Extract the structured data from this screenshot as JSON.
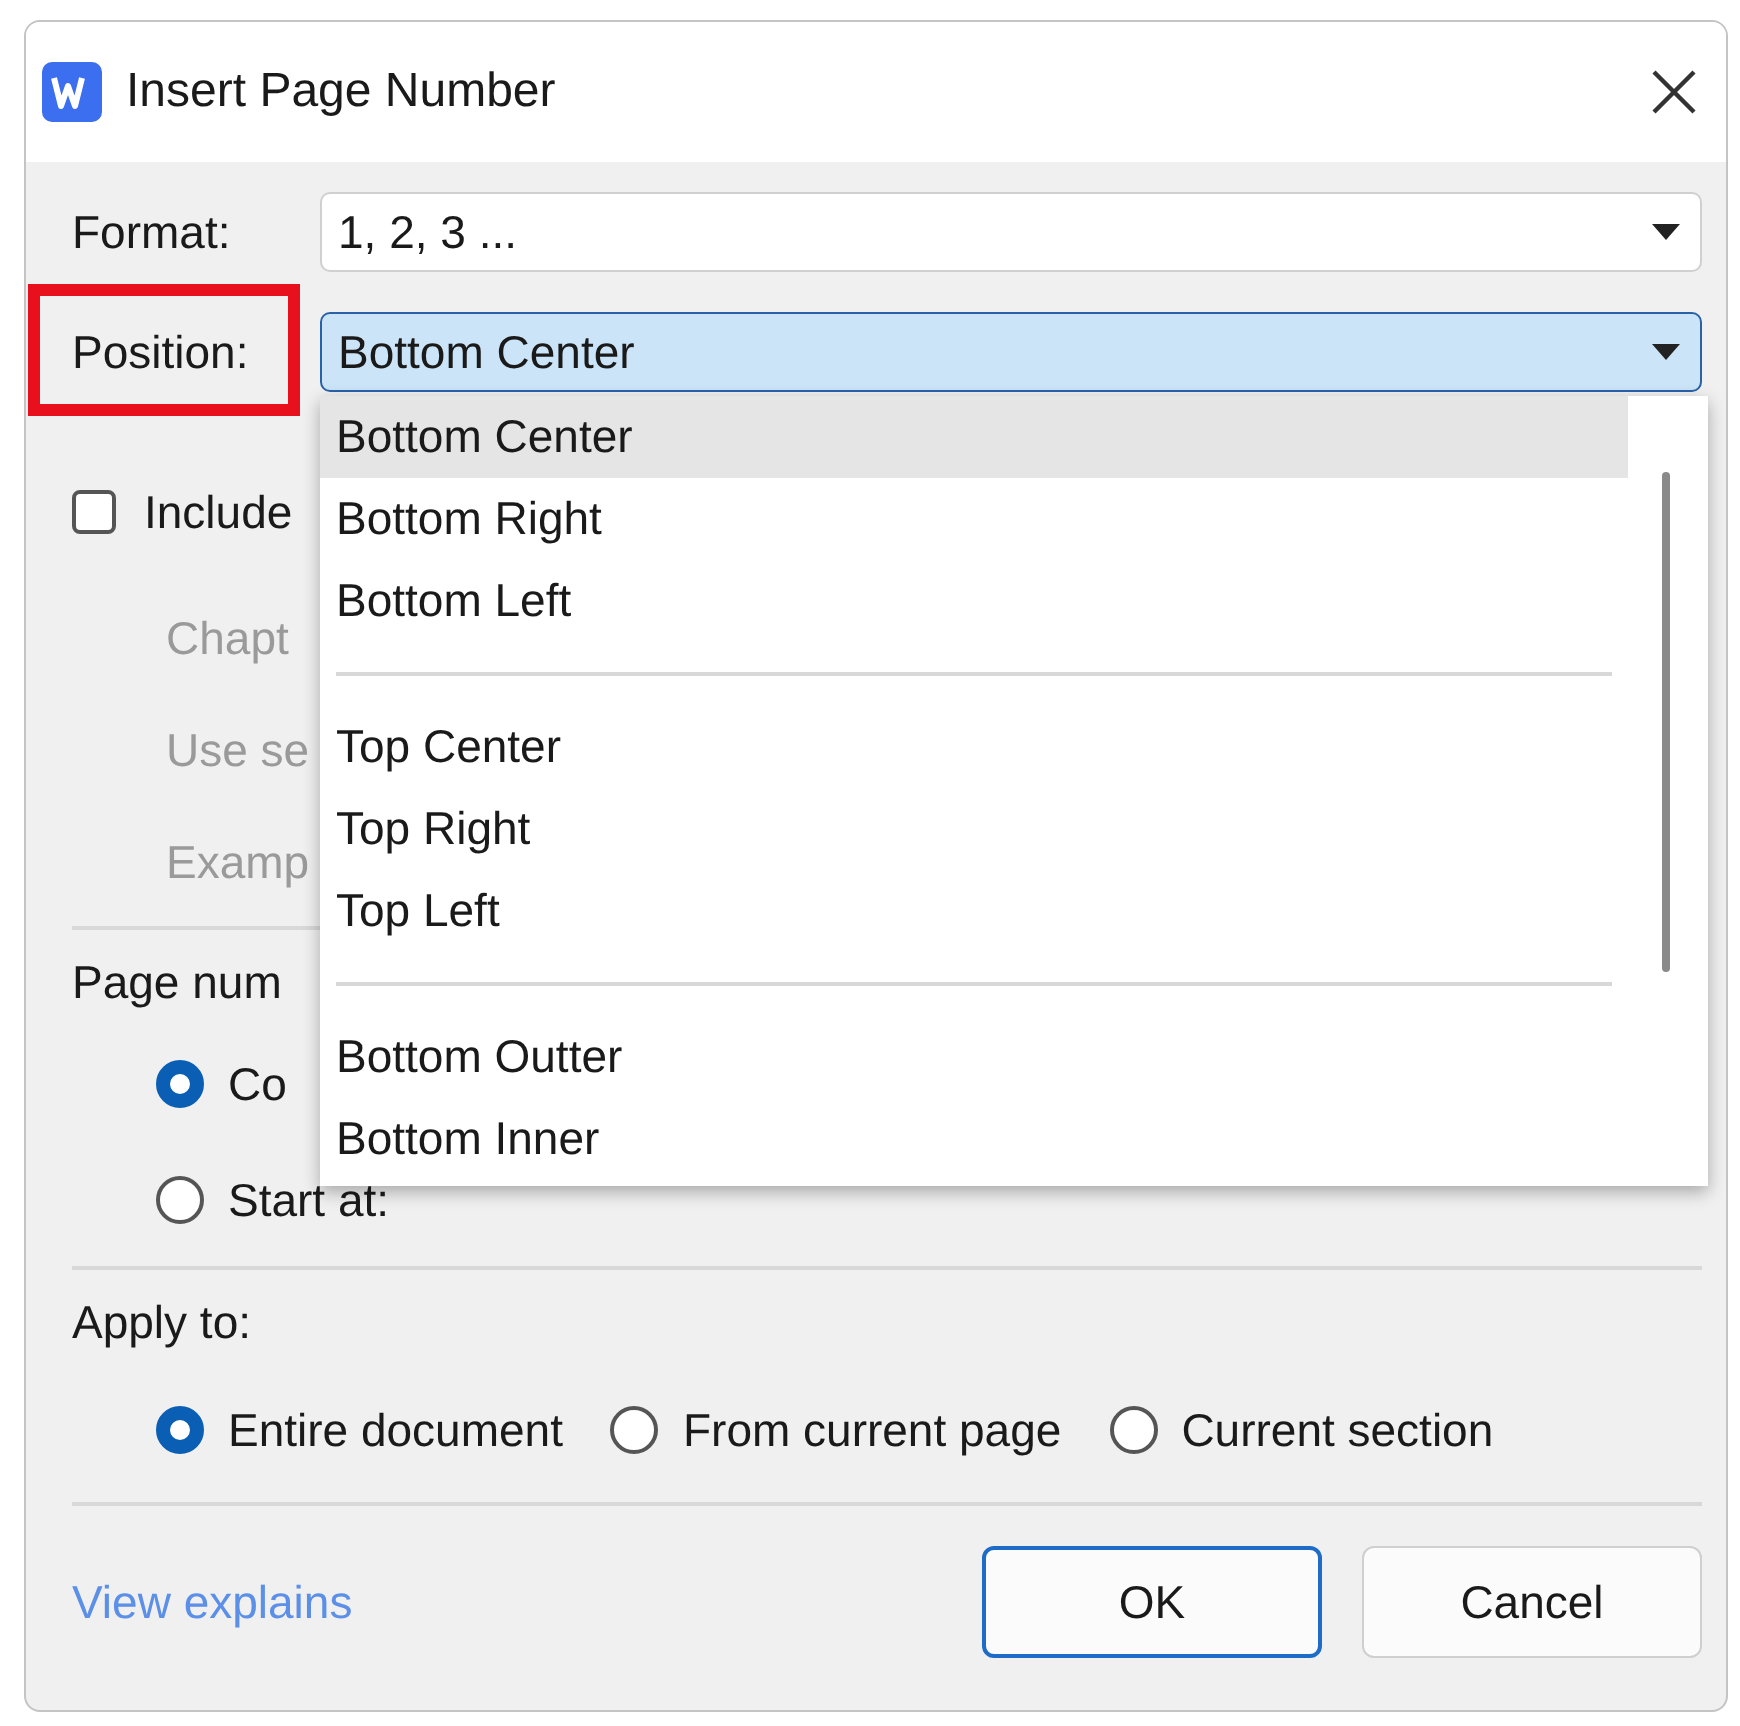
{
  "window": {
    "title": "Insert Page Number"
  },
  "format": {
    "label": "Format:",
    "value": "1, 2, 3 ..."
  },
  "position": {
    "label": "Position:",
    "value": "Bottom Center",
    "expanded": true,
    "annotated": true
  },
  "include_chapter": {
    "label": "Include",
    "checked": false
  },
  "disabled_rows": [
    "Chapt",
    "Use se",
    "Examp"
  ],
  "page_numbering": {
    "label": "Page num",
    "options": [
      {
        "label": "Co",
        "selected": true
      },
      {
        "label": "Start at:",
        "selected": false
      }
    ]
  },
  "dropdown": {
    "groups": [
      [
        {
          "label": "Bottom Center",
          "selected": true
        },
        {
          "label": "Bottom Right",
          "selected": false
        },
        {
          "label": "Bottom Left",
          "selected": false
        }
      ],
      [
        {
          "label": "Top Center",
          "selected": false
        },
        {
          "label": "Top Right",
          "selected": false
        },
        {
          "label": "Top Left",
          "selected": false
        }
      ],
      [
        {
          "label": "Bottom Outter",
          "selected": false
        },
        {
          "label": "Bottom Inner",
          "selected": false
        }
      ]
    ]
  },
  "apply_to": {
    "label": "Apply to:",
    "options": [
      {
        "label": "Entire document",
        "selected": true
      },
      {
        "label": "From current page",
        "selected": false
      },
      {
        "label": "Current section",
        "selected": false
      }
    ]
  },
  "link": "View explains",
  "buttons": [
    {
      "label": "OK",
      "default": true
    },
    {
      "label": "Cancel",
      "default": false
    }
  ]
}
